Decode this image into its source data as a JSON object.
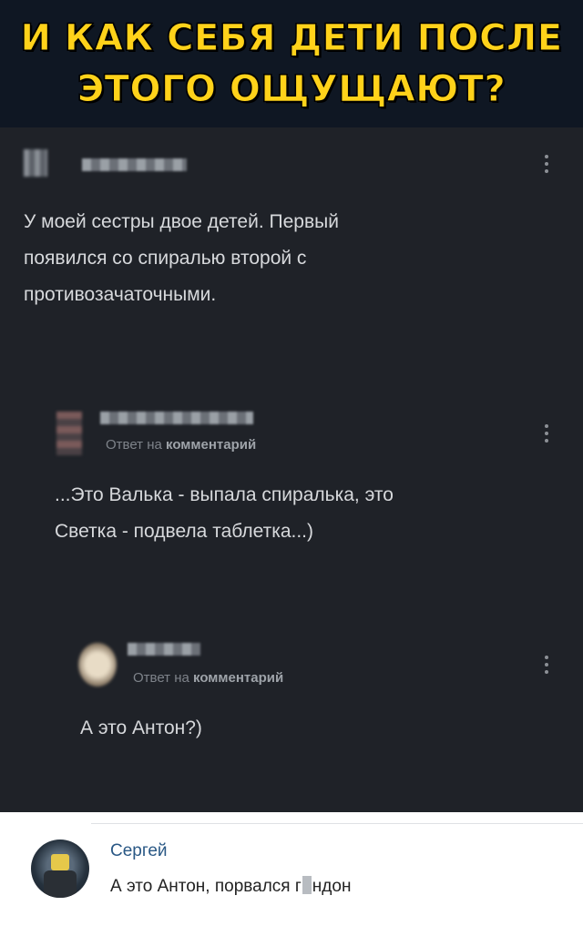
{
  "banner": {
    "line1": "И КАК СЕБЯ ДЕТИ ПОСЛЕ",
    "line2": "ЭТОГО ОЩУЩАЮТ?",
    "color": "#ffd21a"
  },
  "thread": {
    "comment1": {
      "text_lines": [
        "У моей сестры двое детей. Первый",
        "появился со спиралью второй с",
        "противозачаточными."
      ]
    },
    "comment2": {
      "meta_prefix": "Ответ на ",
      "meta_bold": "комментарий",
      "text_lines": [
        "...Это Валька - выпала спиралька, это",
        "Светка - подвела таблетка...)"
      ]
    },
    "comment3": {
      "meta_prefix": "Ответ на ",
      "meta_bold": "комментарий",
      "text_lines": [
        "А это Антон?)"
      ]
    }
  },
  "vk_comment": {
    "author": "Сергей",
    "text_before": "А это Антон, порвался г",
    "text_after": "ндон",
    "name_color": "#2a5885"
  },
  "icons": [
    "more-vertical-icon",
    "avatar"
  ]
}
